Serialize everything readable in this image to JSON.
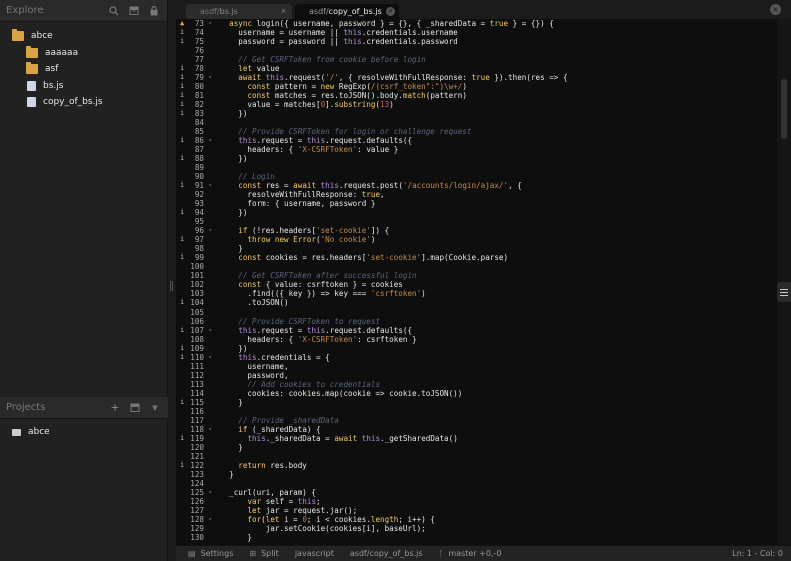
{
  "sidebar": {
    "explore_title": "Explore",
    "tree": [
      {
        "label": "abce",
        "type": "folder",
        "indent": 0
      },
      {
        "label": "aaaaaa",
        "type": "folder",
        "indent": 1
      },
      {
        "label": "asf",
        "type": "folder",
        "indent": 1
      },
      {
        "label": "bs.js",
        "type": "file",
        "indent": 1
      },
      {
        "label": "copy_of_bs.js",
        "type": "file",
        "indent": 1
      }
    ],
    "projects_title": "Projects",
    "projects": [
      {
        "label": "abce"
      }
    ]
  },
  "tabs": [
    {
      "prefix": "asdf/",
      "name": "bs.js",
      "active": false
    },
    {
      "prefix": "asdf/",
      "name": "copy_of_bs.js",
      "active": true
    }
  ],
  "editor": {
    "lines": [
      {
        "n": 73,
        "m": "warn",
        "f": true,
        "t": [
          [
            "  ",
            ""
          ],
          [
            "async",
            "kw"
          ],
          [
            " login({ username, password } = {}, { _sharedData = ",
            ""
          ],
          [
            "true",
            "kw"
          ],
          [
            " } = {}) {",
            ""
          ]
        ]
      },
      {
        "n": 74,
        "m": "i",
        "f": false,
        "t": [
          [
            "    username = username || ",
            ""
          ],
          [
            "this",
            "th"
          ],
          [
            ".credentials.username",
            ""
          ]
        ]
      },
      {
        "n": 75,
        "m": "i",
        "f": false,
        "t": [
          [
            "    password = password || ",
            ""
          ],
          [
            "this",
            "th"
          ],
          [
            ".credentials.password",
            ""
          ]
        ]
      },
      {
        "n": 76,
        "m": "",
        "f": false,
        "t": [
          [
            "",
            ""
          ]
        ]
      },
      {
        "n": 77,
        "m": "",
        "f": false,
        "t": [
          [
            "    // Get CSRFToken from cookie before login",
            "cm"
          ]
        ]
      },
      {
        "n": 78,
        "m": "i",
        "f": false,
        "t": [
          [
            "    ",
            ""
          ],
          [
            "let",
            "kw"
          ],
          [
            " value",
            ""
          ]
        ]
      },
      {
        "n": 79,
        "m": "i",
        "f": true,
        "t": [
          [
            "    ",
            ""
          ],
          [
            "await",
            "kw"
          ],
          [
            " ",
            ""
          ],
          [
            "this",
            "th"
          ],
          [
            ".request(",
            ""
          ],
          [
            "'/'",
            "st"
          ],
          [
            ", { resolveWithFullResponse: ",
            ""
          ],
          [
            "true",
            "kw"
          ],
          [
            " }).then(res => {",
            ""
          ]
        ]
      },
      {
        "n": 80,
        "m": "i",
        "f": false,
        "t": [
          [
            "      ",
            ""
          ],
          [
            "const",
            "kw"
          ],
          [
            " pattern = ",
            ""
          ],
          [
            "new",
            "kw"
          ],
          [
            " RegExp(",
            ""
          ],
          [
            "/(csrf_token\":\")\\w+/",
            "st"
          ],
          [
            ")",
            ""
          ]
        ]
      },
      {
        "n": 81,
        "m": "i",
        "f": false,
        "t": [
          [
            "      ",
            ""
          ],
          [
            "const",
            "kw"
          ],
          [
            " matches = res.toJSON().body.",
            ""
          ],
          [
            "match",
            "kw"
          ],
          [
            "(pattern)",
            ""
          ]
        ]
      },
      {
        "n": 82,
        "m": "i",
        "f": false,
        "t": [
          [
            "      value = matches[",
            ""
          ],
          [
            "0",
            "nu"
          ],
          [
            "].",
            ""
          ],
          [
            "substring",
            "kw"
          ],
          [
            "(",
            ""
          ],
          [
            "13",
            "nu"
          ],
          [
            ")",
            ""
          ]
        ]
      },
      {
        "n": 83,
        "m": "i",
        "f": false,
        "t": [
          [
            "    })",
            ""
          ]
        ]
      },
      {
        "n": 84,
        "m": "",
        "f": false,
        "t": [
          [
            "",
            ""
          ]
        ]
      },
      {
        "n": 85,
        "m": "",
        "f": false,
        "t": [
          [
            "    // Provide CSRFToken for login or challenge request",
            "cm"
          ]
        ]
      },
      {
        "n": 86,
        "m": "i",
        "f": true,
        "t": [
          [
            "    ",
            ""
          ],
          [
            "this",
            "th"
          ],
          [
            ".request = ",
            ""
          ],
          [
            "this",
            "th"
          ],
          [
            ".request.defaults({",
            ""
          ]
        ]
      },
      {
        "n": 87,
        "m": "",
        "f": false,
        "t": [
          [
            "      headers: { ",
            ""
          ],
          [
            "'X-CSRFToken'",
            "st"
          ],
          [
            ": value }",
            ""
          ]
        ]
      },
      {
        "n": 88,
        "m": "i",
        "f": false,
        "t": [
          [
            "    })",
            ""
          ]
        ]
      },
      {
        "n": 89,
        "m": "",
        "f": false,
        "t": [
          [
            "",
            ""
          ]
        ]
      },
      {
        "n": 90,
        "m": "",
        "f": false,
        "t": [
          [
            "    // Login",
            "cm"
          ]
        ]
      },
      {
        "n": 91,
        "m": "i",
        "f": true,
        "t": [
          [
            "    ",
            ""
          ],
          [
            "const",
            "kw"
          ],
          [
            " res = ",
            ""
          ],
          [
            "await",
            "kw"
          ],
          [
            " ",
            ""
          ],
          [
            "this",
            "th"
          ],
          [
            ".request.post(",
            ""
          ],
          [
            "'/accounts/login/ajax/'",
            "st"
          ],
          [
            ", {",
            ""
          ]
        ]
      },
      {
        "n": 92,
        "m": "",
        "f": false,
        "t": [
          [
            "      resolveWithFullResponse: ",
            ""
          ],
          [
            "true",
            "kw"
          ],
          [
            ",",
            ""
          ]
        ]
      },
      {
        "n": 93,
        "m": "",
        "f": false,
        "t": [
          [
            "      form: { username, password }",
            ""
          ]
        ]
      },
      {
        "n": 94,
        "m": "i",
        "f": false,
        "t": [
          [
            "    })",
            ""
          ]
        ]
      },
      {
        "n": 95,
        "m": "",
        "f": false,
        "t": [
          [
            "",
            ""
          ]
        ]
      },
      {
        "n": 96,
        "m": "",
        "f": true,
        "t": [
          [
            "    ",
            ""
          ],
          [
            "if",
            "kw"
          ],
          [
            " (!res.headers[",
            ""
          ],
          [
            "'set-cookie'",
            "st"
          ],
          [
            "]) {",
            ""
          ]
        ]
      },
      {
        "n": 97,
        "m": "i",
        "f": false,
        "t": [
          [
            "      ",
            ""
          ],
          [
            "throw",
            "kw"
          ],
          [
            " ",
            ""
          ],
          [
            "new",
            "kw"
          ],
          [
            " ",
            ""
          ],
          [
            "Error",
            "kw"
          ],
          [
            "(",
            ""
          ],
          [
            "'No cookie'",
            "st"
          ],
          [
            ")",
            ""
          ]
        ]
      },
      {
        "n": 98,
        "m": "",
        "f": false,
        "t": [
          [
            "    }",
            ""
          ]
        ]
      },
      {
        "n": 99,
        "m": "i",
        "f": false,
        "t": [
          [
            "    ",
            ""
          ],
          [
            "const",
            "kw"
          ],
          [
            " cookies = res.headers[",
            ""
          ],
          [
            "'set-cookie'",
            "st"
          ],
          [
            "].map(Cookie.parse)",
            ""
          ]
        ]
      },
      {
        "n": 100,
        "m": "",
        "f": false,
        "t": [
          [
            "",
            ""
          ]
        ]
      },
      {
        "n": 101,
        "m": "",
        "f": false,
        "t": [
          [
            "    // Get CSRFToken after successful login",
            "cm"
          ]
        ]
      },
      {
        "n": 102,
        "m": "",
        "f": false,
        "t": [
          [
            "    ",
            ""
          ],
          [
            "const",
            "kw"
          ],
          [
            " { value: csrftoken } = cookies",
            ""
          ]
        ]
      },
      {
        "n": 103,
        "m": "",
        "f": false,
        "t": [
          [
            "      .find(({ key }) => key === ",
            ""
          ],
          [
            "'csrftoken'",
            "st"
          ],
          [
            ")",
            ""
          ]
        ]
      },
      {
        "n": 104,
        "m": "i",
        "f": false,
        "t": [
          [
            "      .toJSON()",
            ""
          ]
        ]
      },
      {
        "n": 105,
        "m": "",
        "f": false,
        "t": [
          [
            "",
            ""
          ]
        ]
      },
      {
        "n": 106,
        "m": "",
        "f": false,
        "t": [
          [
            "    // Provide CSRFToken to request",
            "cm"
          ]
        ]
      },
      {
        "n": 107,
        "m": "i",
        "f": true,
        "t": [
          [
            "    ",
            ""
          ],
          [
            "this",
            "th"
          ],
          [
            ".request = ",
            ""
          ],
          [
            "this",
            "th"
          ],
          [
            ".request.defaults({",
            ""
          ]
        ]
      },
      {
        "n": 108,
        "m": "",
        "f": false,
        "t": [
          [
            "      headers: { ",
            ""
          ],
          [
            "'X-CSRFToken'",
            "st"
          ],
          [
            ": csrftoken }",
            ""
          ]
        ]
      },
      {
        "n": 109,
        "m": "i",
        "f": false,
        "t": [
          [
            "    })",
            ""
          ]
        ]
      },
      {
        "n": 110,
        "m": "i",
        "f": true,
        "t": [
          [
            "    ",
            ""
          ],
          [
            "this",
            "th"
          ],
          [
            ".credentials = {",
            ""
          ]
        ]
      },
      {
        "n": 111,
        "m": "",
        "f": false,
        "t": [
          [
            "      username,",
            ""
          ]
        ]
      },
      {
        "n": 112,
        "m": "",
        "f": false,
        "t": [
          [
            "      password,",
            ""
          ]
        ]
      },
      {
        "n": 113,
        "m": "",
        "f": false,
        "t": [
          [
            "      // Add cookies to credentials",
            "cm"
          ]
        ]
      },
      {
        "n": 114,
        "m": "",
        "f": false,
        "t": [
          [
            "      cookies: cookies.map(cookie => cookie.toJSON())",
            ""
          ]
        ]
      },
      {
        "n": 115,
        "m": "i",
        "f": false,
        "t": [
          [
            "    }",
            ""
          ]
        ]
      },
      {
        "n": 116,
        "m": "",
        "f": false,
        "t": [
          [
            "",
            ""
          ]
        ]
      },
      {
        "n": 117,
        "m": "",
        "f": false,
        "t": [
          [
            "    // Provide _sharedData",
            "cm"
          ]
        ]
      },
      {
        "n": 118,
        "m": "",
        "f": true,
        "t": [
          [
            "    ",
            ""
          ],
          [
            "if",
            "kw"
          ],
          [
            " (_sharedData) {",
            ""
          ]
        ]
      },
      {
        "n": 119,
        "m": "i",
        "f": false,
        "t": [
          [
            "      ",
            ""
          ],
          [
            "this",
            "th"
          ],
          [
            "._sharedData = ",
            ""
          ],
          [
            "await",
            "kw"
          ],
          [
            " ",
            ""
          ],
          [
            "this",
            "th"
          ],
          [
            "._getSharedData()",
            ""
          ]
        ]
      },
      {
        "n": 120,
        "m": "",
        "f": false,
        "t": [
          [
            "    }",
            ""
          ]
        ]
      },
      {
        "n": 121,
        "m": "",
        "f": false,
        "t": [
          [
            "",
            ""
          ]
        ]
      },
      {
        "n": 122,
        "m": "i",
        "f": false,
        "t": [
          [
            "    ",
            ""
          ],
          [
            "return",
            "kw"
          ],
          [
            " res.body",
            ""
          ]
        ]
      },
      {
        "n": 123,
        "m": "",
        "f": false,
        "t": [
          [
            "  }",
            ""
          ]
        ]
      },
      {
        "n": 124,
        "m": "",
        "f": false,
        "t": [
          [
            "",
            ""
          ]
        ]
      },
      {
        "n": 125,
        "m": "",
        "f": true,
        "t": [
          [
            "  _curl(uri, param) {",
            ""
          ]
        ]
      },
      {
        "n": 126,
        "m": "",
        "f": false,
        "t": [
          [
            "      ",
            ""
          ],
          [
            "var",
            "kw"
          ],
          [
            " self = ",
            ""
          ],
          [
            "this",
            "th"
          ],
          [
            ";",
            ""
          ]
        ]
      },
      {
        "n": 127,
        "m": "",
        "f": false,
        "t": [
          [
            "      ",
            ""
          ],
          [
            "let",
            "kw"
          ],
          [
            " jar = request.jar();",
            ""
          ]
        ]
      },
      {
        "n": 128,
        "m": "",
        "f": true,
        "t": [
          [
            "      ",
            ""
          ],
          [
            "for",
            "kw"
          ],
          [
            "(",
            ""
          ],
          [
            "let",
            "kw"
          ],
          [
            " i = ",
            ""
          ],
          [
            "0",
            "nu"
          ],
          [
            "; i < cookies.",
            ""
          ],
          [
            "length",
            "kw"
          ],
          [
            "; i++) {",
            ""
          ]
        ]
      },
      {
        "n": 129,
        "m": "",
        "f": false,
        "t": [
          [
            "          jar.setCookie(cookies[i], baseUrl);",
            ""
          ]
        ]
      },
      {
        "n": 130,
        "m": "",
        "f": false,
        "t": [
          [
            "      }",
            ""
          ]
        ]
      }
    ]
  },
  "statusbar": {
    "settings": "Settings",
    "split": "Split",
    "language": "javascript",
    "file_path": "asdf/copy_of_bs.js",
    "git": "master +0,-0",
    "cursor": "Ln: 1 - Col: 0"
  }
}
